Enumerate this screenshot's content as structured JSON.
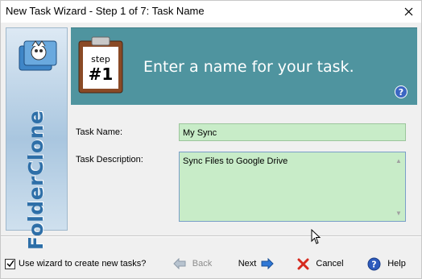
{
  "window": {
    "title": "New Task Wizard - Step 1 of 7: Task Name",
    "close_glyph": "✕"
  },
  "sidebar": {
    "brand": "FolderClone"
  },
  "banner": {
    "step_word": "step",
    "step_number": "#1",
    "heading": "Enter a name for your task.",
    "help_glyph": "?"
  },
  "form": {
    "task_name_label": "Task Name:",
    "task_name_value": "My Sync",
    "task_description_label": "Task Description:",
    "task_description_value": "Sync Files to Google Drive"
  },
  "footer": {
    "checkbox_label": "Use wizard to create new tasks?",
    "checkbox_checked": true,
    "back_label": "Back",
    "next_label": "Next",
    "cancel_label": "Cancel",
    "help_label": "Help"
  },
  "colors": {
    "banner": "#4f949f",
    "input_bg": "#c8ecc8",
    "brand_text": "#2e6fa8"
  }
}
